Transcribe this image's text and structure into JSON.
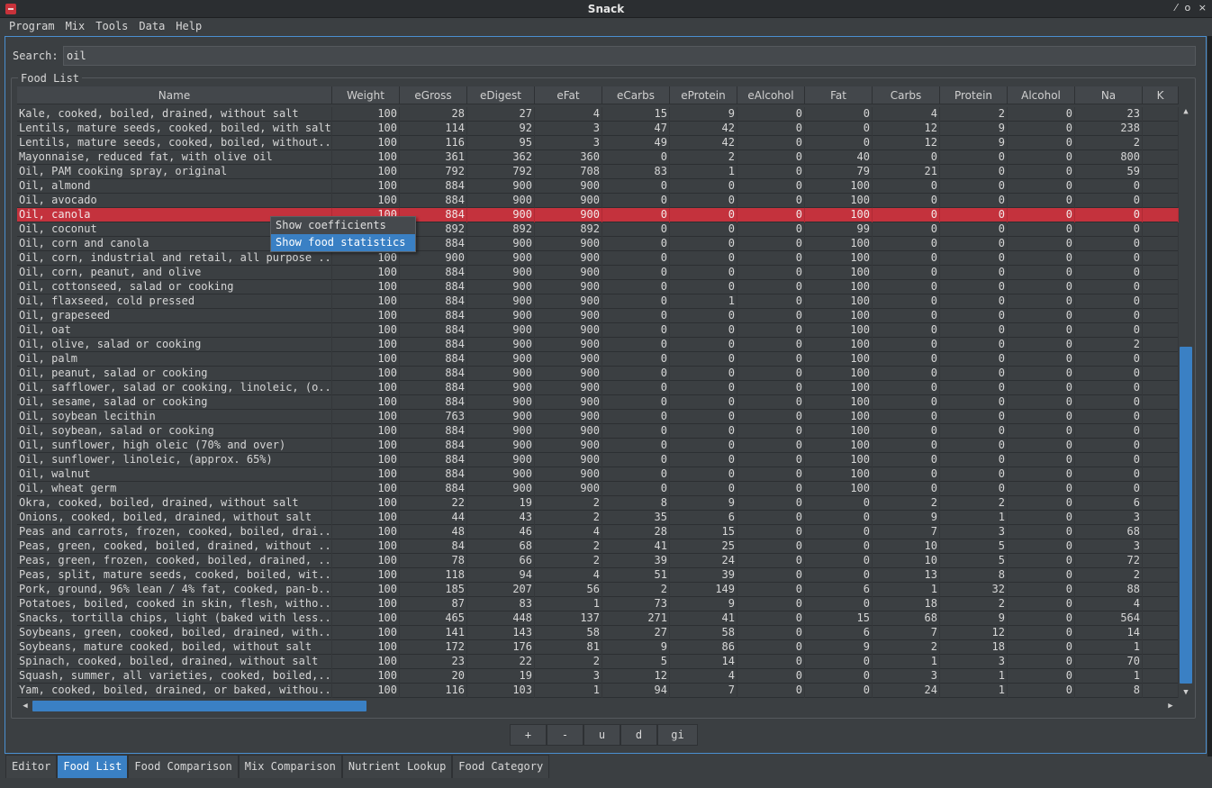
{
  "window": {
    "title": "Snack",
    "controls": [
      "⁄",
      "o",
      "×"
    ]
  },
  "menu": [
    "Program",
    "Mix",
    "Tools",
    "Data",
    "Help"
  ],
  "search": {
    "label": "Search:",
    "value": "oil"
  },
  "group_title": "Food List",
  "columns": [
    "Name",
    "Weight",
    "eGross",
    "eDigest",
    "eFat",
    "eCarbs",
    "eProtein",
    "eAlcohol",
    "Fat",
    "Carbs",
    "Protein",
    "Alcohol",
    "Na",
    "K"
  ],
  "rows": [
    [
      "Kale, cooked, boiled, drained, without salt",
      "100",
      "28",
      "27",
      "4",
      "15",
      "9",
      "0",
      "0",
      "4",
      "2",
      "0",
      "23"
    ],
    [
      "Lentils, mature seeds, cooked, boiled, with salt",
      "100",
      "114",
      "92",
      "3",
      "47",
      "42",
      "0",
      "0",
      "12",
      "9",
      "0",
      "238"
    ],
    [
      "Lentils, mature seeds, cooked, boiled, without...",
      "100",
      "116",
      "95",
      "3",
      "49",
      "42",
      "0",
      "0",
      "12",
      "9",
      "0",
      "2"
    ],
    [
      "Mayonnaise, reduced fat, with olive oil",
      "100",
      "361",
      "362",
      "360",
      "0",
      "2",
      "0",
      "40",
      "0",
      "0",
      "0",
      "800"
    ],
    [
      "Oil, PAM cooking spray, original",
      "100",
      "792",
      "792",
      "708",
      "83",
      "1",
      "0",
      "79",
      "21",
      "0",
      "0",
      "59"
    ],
    [
      "Oil, almond",
      "100",
      "884",
      "900",
      "900",
      "0",
      "0",
      "0",
      "100",
      "0",
      "0",
      "0",
      "0"
    ],
    [
      "Oil, avocado",
      "100",
      "884",
      "900",
      "900",
      "0",
      "0",
      "0",
      "100",
      "0",
      "0",
      "0",
      "0"
    ],
    [
      "Oil, canola",
      "100",
      "884",
      "900",
      "900",
      "0",
      "0",
      "0",
      "100",
      "0",
      "0",
      "0",
      "0"
    ],
    [
      "Oil, coconut",
      "100",
      "892",
      "892",
      "892",
      "0",
      "0",
      "0",
      "99",
      "0",
      "0",
      "0",
      "0"
    ],
    [
      "Oil, corn and canola",
      "100",
      "884",
      "900",
      "900",
      "0",
      "0",
      "0",
      "100",
      "0",
      "0",
      "0",
      "0"
    ],
    [
      "Oil, corn, industrial and retail, all purpose ...",
      "100",
      "900",
      "900",
      "900",
      "0",
      "0",
      "0",
      "100",
      "0",
      "0",
      "0",
      "0"
    ],
    [
      "Oil, corn, peanut, and olive",
      "100",
      "884",
      "900",
      "900",
      "0",
      "0",
      "0",
      "100",
      "0",
      "0",
      "0",
      "0"
    ],
    [
      "Oil, cottonseed, salad or cooking",
      "100",
      "884",
      "900",
      "900",
      "0",
      "0",
      "0",
      "100",
      "0",
      "0",
      "0",
      "0"
    ],
    [
      "Oil, flaxseed, cold pressed",
      "100",
      "884",
      "900",
      "900",
      "0",
      "1",
      "0",
      "100",
      "0",
      "0",
      "0",
      "0"
    ],
    [
      "Oil, grapeseed",
      "100",
      "884",
      "900",
      "900",
      "0",
      "0",
      "0",
      "100",
      "0",
      "0",
      "0",
      "0"
    ],
    [
      "Oil, oat",
      "100",
      "884",
      "900",
      "900",
      "0",
      "0",
      "0",
      "100",
      "0",
      "0",
      "0",
      "0"
    ],
    [
      "Oil, olive, salad or cooking",
      "100",
      "884",
      "900",
      "900",
      "0",
      "0",
      "0",
      "100",
      "0",
      "0",
      "0",
      "2"
    ],
    [
      "Oil, palm",
      "100",
      "884",
      "900",
      "900",
      "0",
      "0",
      "0",
      "100",
      "0",
      "0",
      "0",
      "0"
    ],
    [
      "Oil, peanut, salad or cooking",
      "100",
      "884",
      "900",
      "900",
      "0",
      "0",
      "0",
      "100",
      "0",
      "0",
      "0",
      "0"
    ],
    [
      "Oil, safflower, salad or cooking, linoleic, (o...",
      "100",
      "884",
      "900",
      "900",
      "0",
      "0",
      "0",
      "100",
      "0",
      "0",
      "0",
      "0"
    ],
    [
      "Oil, sesame, salad or cooking",
      "100",
      "884",
      "900",
      "900",
      "0",
      "0",
      "0",
      "100",
      "0",
      "0",
      "0",
      "0"
    ],
    [
      "Oil, soybean lecithin",
      "100",
      "763",
      "900",
      "900",
      "0",
      "0",
      "0",
      "100",
      "0",
      "0",
      "0",
      "0"
    ],
    [
      "Oil, soybean, salad or cooking",
      "100",
      "884",
      "900",
      "900",
      "0",
      "0",
      "0",
      "100",
      "0",
      "0",
      "0",
      "0"
    ],
    [
      "Oil, sunflower, high oleic (70% and over)",
      "100",
      "884",
      "900",
      "900",
      "0",
      "0",
      "0",
      "100",
      "0",
      "0",
      "0",
      "0"
    ],
    [
      "Oil, sunflower, linoleic, (approx. 65%)",
      "100",
      "884",
      "900",
      "900",
      "0",
      "0",
      "0",
      "100",
      "0",
      "0",
      "0",
      "0"
    ],
    [
      "Oil, walnut",
      "100",
      "884",
      "900",
      "900",
      "0",
      "0",
      "0",
      "100",
      "0",
      "0",
      "0",
      "0"
    ],
    [
      "Oil, wheat germ",
      "100",
      "884",
      "900",
      "900",
      "0",
      "0",
      "0",
      "100",
      "0",
      "0",
      "0",
      "0"
    ],
    [
      "Okra, cooked, boiled, drained, without salt",
      "100",
      "22",
      "19",
      "2",
      "8",
      "9",
      "0",
      "0",
      "2",
      "2",
      "0",
      "6"
    ],
    [
      "Onions, cooked, boiled, drained, without salt",
      "100",
      "44",
      "43",
      "2",
      "35",
      "6",
      "0",
      "0",
      "9",
      "1",
      "0",
      "3"
    ],
    [
      "Peas and carrots, frozen, cooked, boiled, drai...",
      "100",
      "48",
      "46",
      "4",
      "28",
      "15",
      "0",
      "0",
      "7",
      "3",
      "0",
      "68"
    ],
    [
      "Peas, green, cooked, boiled, drained, without ...",
      "100",
      "84",
      "68",
      "2",
      "41",
      "25",
      "0",
      "0",
      "10",
      "5",
      "0",
      "3"
    ],
    [
      "Peas, green, frozen, cooked, boiled, drained, ...",
      "100",
      "78",
      "66",
      "2",
      "39",
      "24",
      "0",
      "0",
      "10",
      "5",
      "0",
      "72"
    ],
    [
      "Peas, split, mature seeds, cooked, boiled, wit...",
      "100",
      "118",
      "94",
      "4",
      "51",
      "39",
      "0",
      "0",
      "13",
      "8",
      "0",
      "2"
    ],
    [
      "Pork, ground, 96% lean / 4% fat, cooked, pan-b...",
      "100",
      "185",
      "207",
      "56",
      "2",
      "149",
      "0",
      "6",
      "1",
      "32",
      "0",
      "88"
    ],
    [
      "Potatoes, boiled, cooked in skin, flesh, witho...",
      "100",
      "87",
      "83",
      "1",
      "73",
      "9",
      "0",
      "0",
      "18",
      "2",
      "0",
      "4"
    ],
    [
      "Snacks, tortilla chips, light (baked with less...",
      "100",
      "465",
      "448",
      "137",
      "271",
      "41",
      "0",
      "15",
      "68",
      "9",
      "0",
      "564"
    ],
    [
      "Soybeans, green, cooked, boiled, drained, with...",
      "100",
      "141",
      "143",
      "58",
      "27",
      "58",
      "0",
      "6",
      "7",
      "12",
      "0",
      "14"
    ],
    [
      "Soybeans, mature cooked, boiled, without salt",
      "100",
      "172",
      "176",
      "81",
      "9",
      "86",
      "0",
      "9",
      "2",
      "18",
      "0",
      "1"
    ],
    [
      "Spinach, cooked, boiled, drained, without salt",
      "100",
      "23",
      "22",
      "2",
      "5",
      "14",
      "0",
      "0",
      "1",
      "3",
      "0",
      "70"
    ],
    [
      "Squash, summer, all varieties, cooked, boiled,...",
      "100",
      "20",
      "19",
      "3",
      "12",
      "4",
      "0",
      "0",
      "3",
      "1",
      "0",
      "1"
    ],
    [
      "Yam, cooked, boiled, drained, or baked, withou...",
      "100",
      "116",
      "103",
      "1",
      "94",
      "7",
      "0",
      "0",
      "24",
      "1",
      "0",
      "8"
    ]
  ],
  "selected_row": 7,
  "context_menu": [
    "Show coefficients",
    "Show food statistics"
  ],
  "buttons": [
    "+",
    "-",
    "u",
    "d",
    "gi"
  ],
  "tabs": [
    "Editor",
    "Food List",
    "Food Comparison",
    "Mix Comparison",
    "Nutrient Lookup",
    "Food Category"
  ],
  "active_tab": 1,
  "colors": {
    "selection": "#c4323d",
    "accent": "#3a80c4",
    "background": "#3b3f42"
  }
}
